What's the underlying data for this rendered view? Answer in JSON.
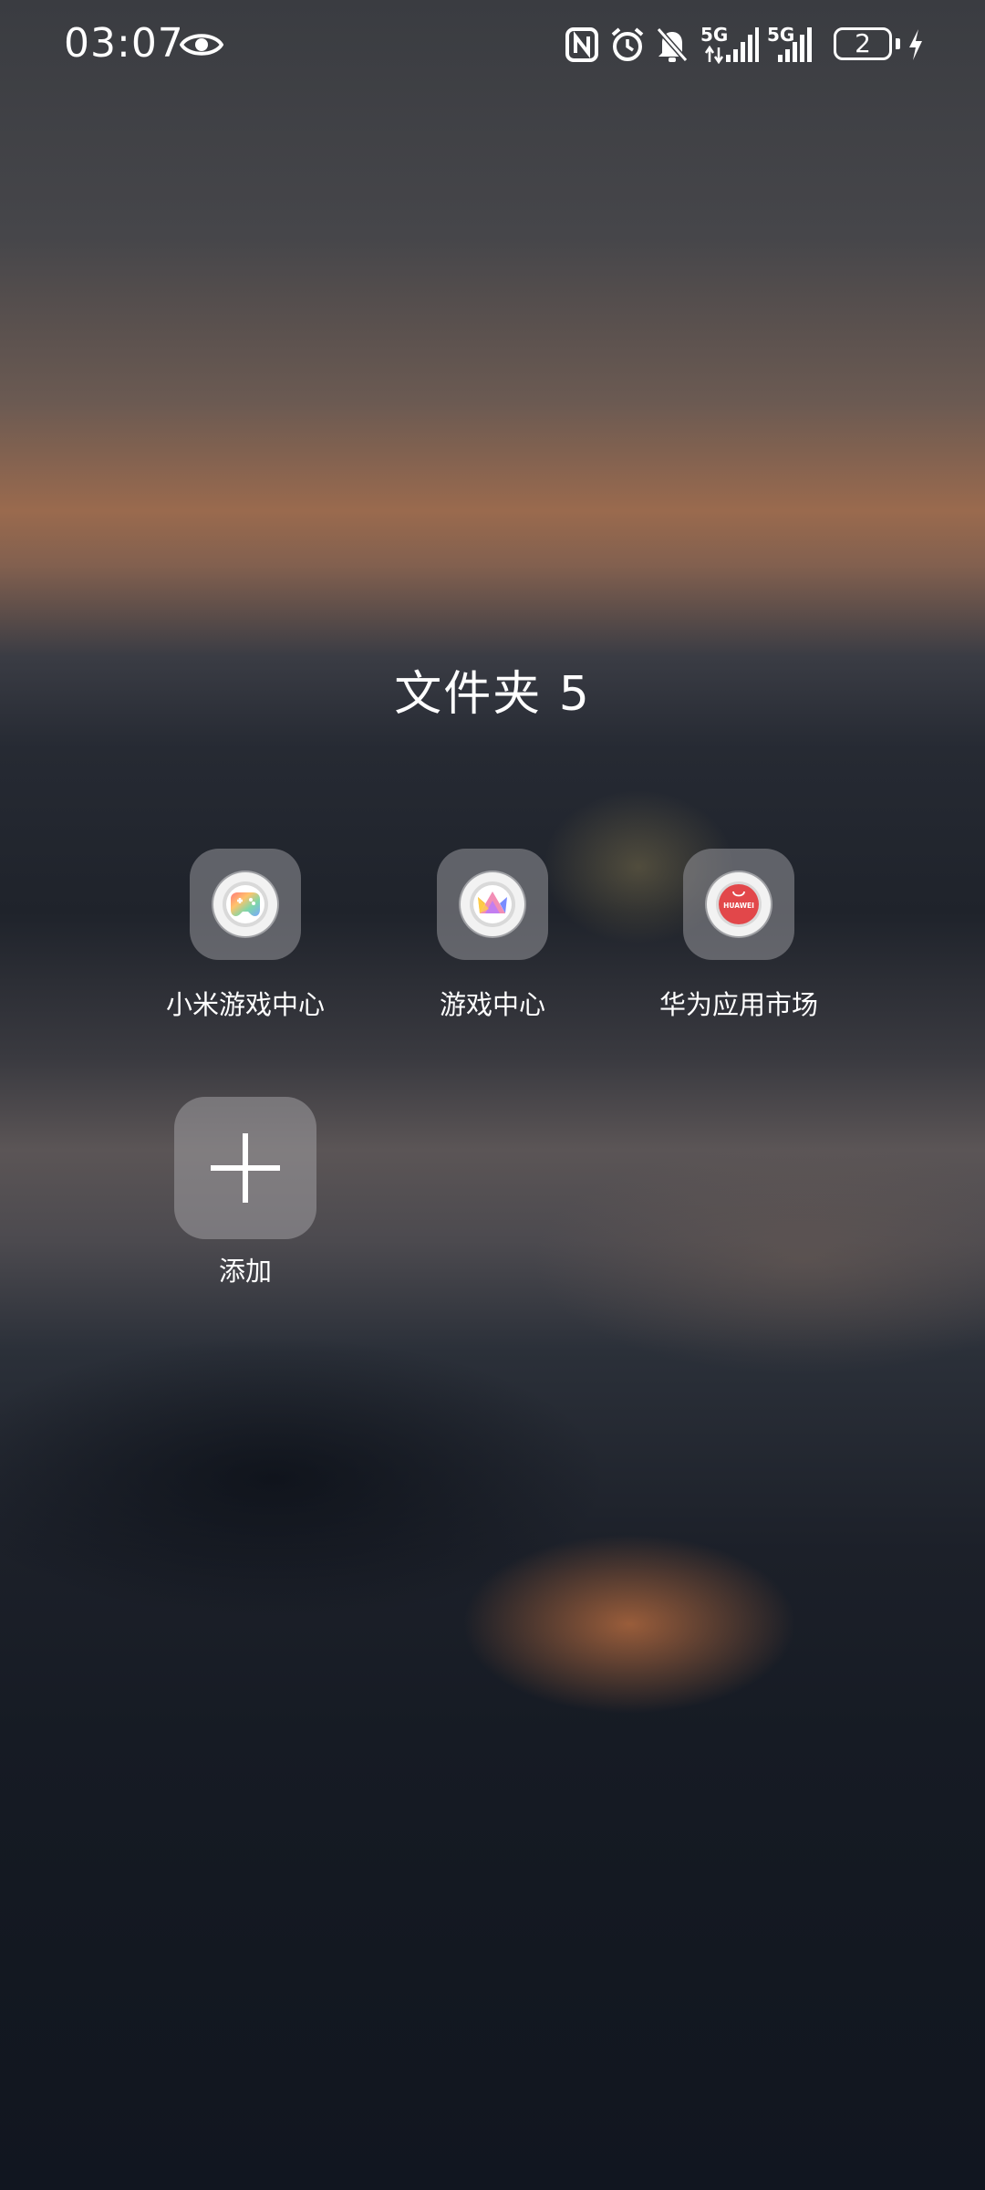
{
  "status_bar": {
    "time": "03:07",
    "signal1_label": "5G",
    "signal2_label": "5G",
    "battery_level": "2",
    "icons": [
      "eye-icon",
      "nfc-icon",
      "alarm-icon",
      "bell-off-icon",
      "signal-icon",
      "signal-icon",
      "battery-icon",
      "charging-icon"
    ]
  },
  "folder": {
    "title": "文件夹 5",
    "apps": [
      {
        "label": "小米游戏中心",
        "icon": "xiaomi-game-center-icon"
      },
      {
        "label": "游戏中心",
        "icon": "game-center-icon"
      },
      {
        "label": "华为应用市场",
        "icon": "huawei-appgallery-icon",
        "logo_text": "HUAWEI"
      }
    ],
    "add_label": "添加"
  },
  "colors": {
    "text": "#ffffff",
    "huawei_red": "#e2474a"
  }
}
